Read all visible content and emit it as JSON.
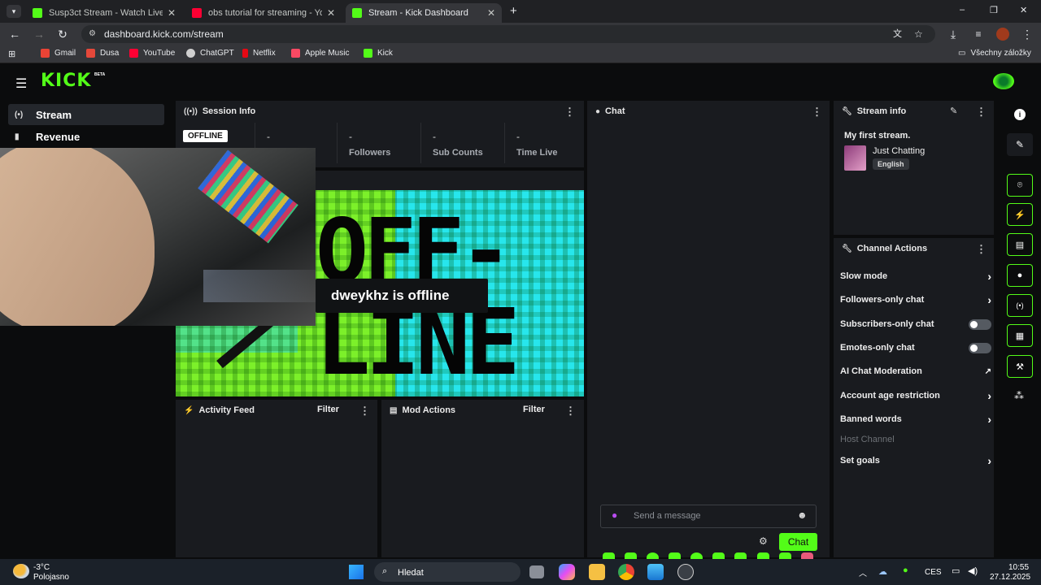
{
  "browser": {
    "tabs": [
      {
        "title": "Susp3ct Stream - Watch Live on",
        "color": "#53fc18",
        "active": false
      },
      {
        "title": "obs tutorial for streaming - You",
        "color": "#ff0033",
        "active": false
      },
      {
        "title": "Stream - Kick Dashboard",
        "color": "#53fc18",
        "active": true
      }
    ],
    "new_tab": "+",
    "window_controls": {
      "minimize": "–",
      "maximize": "❐",
      "close": "✕"
    },
    "nav": {
      "back": "←",
      "forward": "→",
      "reload": "↻"
    },
    "url": "dashboard.kick.com/stream",
    "bookmarks": [
      {
        "label": "Gmail",
        "color": "#ea4335"
      },
      {
        "label": "Dusa",
        "color": "#e5483a"
      },
      {
        "label": "YouTube",
        "color": "#ff0033"
      },
      {
        "label": "ChatGPT",
        "color": "#cfcfcf"
      },
      {
        "label": "Netflix",
        "color": "#e50914"
      },
      {
        "label": "Apple Music",
        "color": "#fa4963"
      },
      {
        "label": "Kick",
        "color": "#53fc18"
      }
    ],
    "all_bookmarks": "Všechny záložky"
  },
  "kick": {
    "logo": "KICK",
    "logo_badge": "BETA",
    "accent": "#53fc18",
    "sidebar": [
      {
        "label": "Stream",
        "icon": "broadcast-icon",
        "glyph": "(•)",
        "active": true
      },
      {
        "label": "Revenue",
        "icon": "chart-icon",
        "glyph": "▮",
        "active": false
      }
    ],
    "session_info": {
      "title": "Session Info",
      "status_badge": "OFFLINE",
      "stats": [
        {
          "value": "-",
          "label": ""
        },
        {
          "value": "-",
          "label": "Followers"
        },
        {
          "value": "-",
          "label": "Sub Counts"
        },
        {
          "value": "-",
          "label": "Time Live"
        }
      ]
    },
    "preview": {
      "big_text_1": "OFF-",
      "big_text_2": "LINE",
      "offline_message": "dweykhz is offline"
    },
    "activity_feed": {
      "title": "Activity Feed",
      "filter": "Filter"
    },
    "mod_actions": {
      "title": "Mod Actions",
      "filter": "Filter"
    },
    "chat": {
      "title": "Chat",
      "placeholder": "Send a message",
      "send_label": "Chat",
      "emote_count": 10
    },
    "stream_info": {
      "title": "Stream info",
      "stream_title": "My first stream.",
      "category": "Just Chatting",
      "language": "English"
    },
    "channel_actions": {
      "title": "Channel Actions",
      "items": [
        {
          "label": "Slow mode",
          "control": "chevron"
        },
        {
          "label": "Followers-only chat",
          "control": "chevron"
        },
        {
          "label": "Subscribers-only chat",
          "control": "toggle"
        },
        {
          "label": "Emotes-only chat",
          "control": "toggle"
        },
        {
          "label": "AI Chat Moderation",
          "control": "external"
        },
        {
          "label": "Account age restriction",
          "control": "chevron"
        },
        {
          "label": "Banned words",
          "control": "chevron"
        },
        {
          "label": "Host Channel",
          "control": "disabled"
        },
        {
          "label": "Set goals",
          "control": "chevron"
        }
      ]
    },
    "right_rail": [
      "info-icon",
      "pencil-icon",
      "camera-icon",
      "bolt-icon",
      "notes-icon",
      "chat-icon",
      "broadcast-icon",
      "layout-icon",
      "wrench-icon",
      "users-icon"
    ]
  },
  "taskbar": {
    "weather_temp": "-3°C",
    "weather_desc": "Polojasno",
    "search": "Hledat",
    "language": "CES",
    "time": "10:55",
    "date": "27.12.2025"
  }
}
